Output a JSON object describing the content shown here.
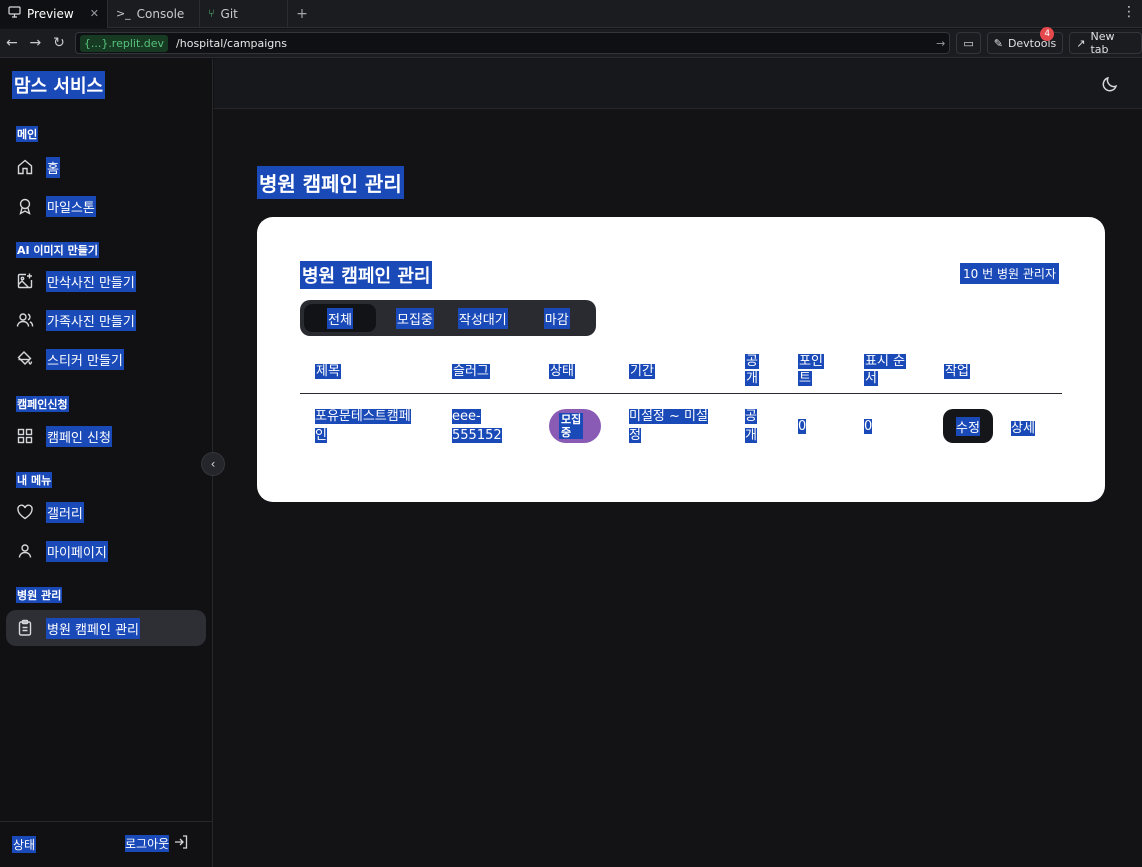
{
  "browser": {
    "tabs": [
      {
        "label": "Preview",
        "icon": "monitor-icon"
      },
      {
        "label": "Console",
        "icon": "terminal-icon"
      },
      {
        "label": "Git",
        "icon": "git-icon"
      }
    ],
    "domain": "{...}.replit.dev",
    "path": "/hospital/campaigns",
    "devtools_label": "Devtools",
    "devtools_badge": "4",
    "new_tab_label": "New tab"
  },
  "sidebar": {
    "brand": "맘스 서비스",
    "sections": [
      {
        "title": "메인",
        "items": [
          {
            "label": "홈",
            "icon": "home-icon"
          },
          {
            "label": "마일스톤",
            "icon": "award-icon"
          }
        ]
      },
      {
        "title": "AI 이미지 만들기",
        "items": [
          {
            "label": "만삭사진 만들기",
            "icon": "image-plus-icon"
          },
          {
            "label": "가족사진 만들기",
            "icon": "users-icon"
          },
          {
            "label": "스티커 만들기",
            "icon": "paint-bucket-icon"
          }
        ]
      },
      {
        "title": "캠페인신청",
        "items": [
          {
            "label": "캠페인 신청",
            "icon": "grid-icon"
          }
        ]
      },
      {
        "title": "내 메뉴",
        "items": [
          {
            "label": "갤러리",
            "icon": "heart-icon"
          },
          {
            "label": "마이페이지",
            "icon": "user-icon"
          }
        ]
      },
      {
        "title": "병원 관리",
        "items": [
          {
            "label": "병원 캠페인 관리",
            "icon": "clipboard-icon",
            "active": true
          }
        ]
      }
    ],
    "footer": {
      "status": "상태",
      "logout": "로그아웃"
    }
  },
  "main": {
    "page_title": "병원 캠페인 관리",
    "card": {
      "title": "병원 캠페인 관리",
      "admin_label": "10 번 병원 관리자",
      "filter_tabs": [
        "전체",
        "모집중",
        "작성대기",
        "마감"
      ],
      "active_filter": "전체",
      "columns": [
        "제목",
        "슬러그",
        "상태",
        "기간",
        "공개",
        "포인트",
        "표시 순서",
        "작업"
      ],
      "columns_display": {
        "public": [
          "공",
          "개"
        ],
        "points": [
          "포인",
          "트"
        ],
        "order": [
          "표시 순",
          "서"
        ]
      },
      "rows": [
        {
          "title": [
            "포유문테스트캠페",
            "인"
          ],
          "slug": [
            "eee-",
            "555152"
          ],
          "status": [
            "모집",
            "중"
          ],
          "period": [
            "미설정 ~ 미설",
            "정"
          ],
          "public": [
            "공",
            "개"
          ],
          "points": "0",
          "display_order": "0",
          "edit_label": "수정",
          "detail_label": "상세"
        }
      ]
    }
  },
  "colors": {
    "selection": "#1a49b8",
    "status_pill": "#8a5bb4",
    "card_bg": "#ffffff",
    "app_bg": "#131316"
  }
}
